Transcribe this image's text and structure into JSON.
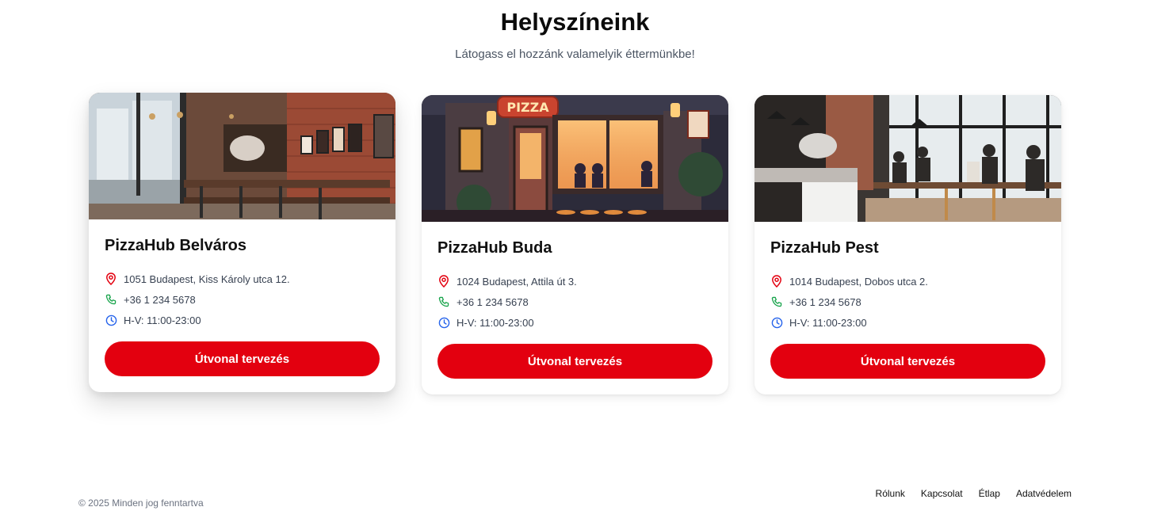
{
  "header": {
    "title": "Helyszíneink",
    "subtitle": "Látogass el hozzánk valamelyik éttermünkbe!"
  },
  "locations": [
    {
      "name": "PizzaHub Belváros",
      "address": "1051 Budapest, Kiss Károly utca 12.",
      "phone": "+36 1 234 5678",
      "hours": "H-V: 11:00-23:00",
      "button_label": "Útvonal tervezés"
    },
    {
      "name": "PizzaHub Buda",
      "address": "1024 Budapest, Attila út 3.",
      "phone": "+36 1 234 5678",
      "hours": "H-V: 11:00-23:00",
      "button_label": "Útvonal tervezés",
      "sign_text": "PIZZA"
    },
    {
      "name": "PizzaHub Pest",
      "address": "1014 Budapest, Dobos utca 2.",
      "phone": "+36 1 234 5678",
      "hours": "H-V: 11:00-23:00",
      "button_label": "Útvonal tervezés"
    }
  ],
  "footer": {
    "copyright": "© 2025 Minden jog fenntartva",
    "links": [
      "Rólunk",
      "Kapcsolat",
      "Étlap",
      "Adatvédelem"
    ]
  },
  "colors": {
    "accent": "#e3000f",
    "address_icon": "#e3000f",
    "phone_icon": "#16a34a",
    "hours_icon": "#2563eb"
  }
}
